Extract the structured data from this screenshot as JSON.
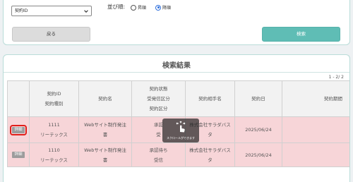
{
  "search": {
    "select_value": "契約ID",
    "sort_label": "並び順:",
    "sort_asc": "昇順",
    "sort_desc": "降順",
    "back_label": "戻る",
    "search_label": "検索"
  },
  "results": {
    "title": "検索結果",
    "page_count": "1 - 2/ 2",
    "headers": {
      "contract_id": "契約ID",
      "contract_type": "契約種別",
      "contract_name": "契約名",
      "status": "契約状態",
      "receive_type": "受発信区分",
      "contract_class": "契約区分",
      "partner": "契約相手名",
      "date": "契約日",
      "period": "契約期間"
    },
    "rows": [
      {
        "detail": "詳細",
        "id": "1111",
        "type": "リーテックス",
        "name_1": "Webサイト制作発注",
        "name_2": "書",
        "status_1": "承認",
        "status_2": "受",
        "partner_1": "株式会社サラダバス",
        "partner_2": "タ",
        "date": "2025/06/24"
      },
      {
        "detail": "詳細",
        "id": "1110",
        "type": "リーテックス",
        "name_1": "Webサイト制作発注",
        "name_2": "書",
        "status_1": "承認待ち",
        "status_2": "受信",
        "partner_1": "株式会社サラダバス",
        "partner_2": "タ",
        "date": "2025/06/24"
      }
    ],
    "scroll_hint": "スクロールができます"
  },
  "colors": {
    "accent": "#5fbdb5",
    "row_highlight": "#f7d5d8",
    "focus_outline": "#e0201b",
    "radio_selected": "#2f6fdc"
  },
  "icons": [
    "chevron-down-icon",
    "swipe-hand-icon"
  ]
}
